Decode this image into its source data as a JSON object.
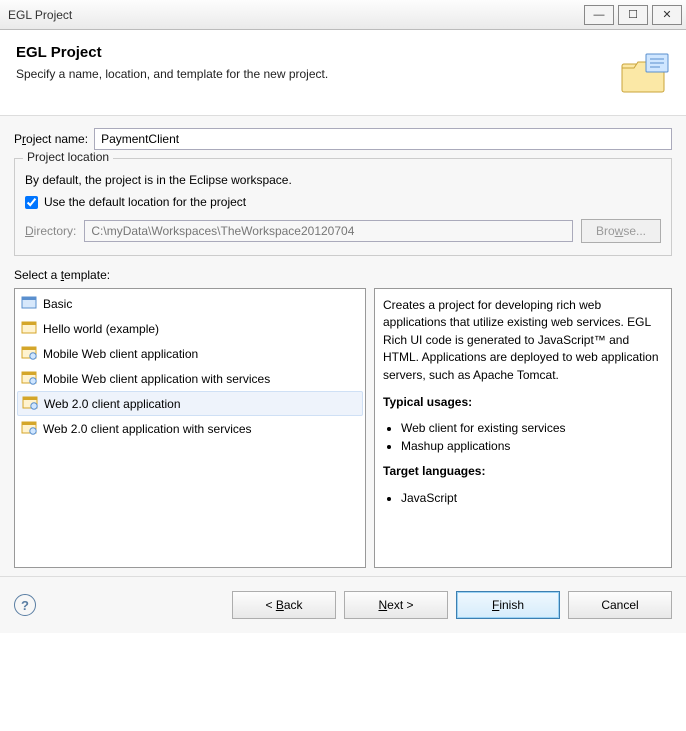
{
  "window": {
    "title": "EGL Project"
  },
  "header": {
    "title": "EGL Project",
    "subtitle": "Specify a name, location, and template for the new project."
  },
  "projectName": {
    "label_pre": "P",
    "label_u": "r",
    "label_post": "oject name:",
    "value": "PaymentClient"
  },
  "location": {
    "legend": "Project location",
    "desc": "By default, the project is in the Eclipse workspace.",
    "checkboxLabel": "Use the default location for the project",
    "checked": true,
    "dir_label_pre": "",
    "dir_label_u": "D",
    "dir_label_post": "irectory:",
    "directory": "C:\\myData\\Workspaces\\TheWorkspace20120704",
    "browse_pre": "Bro",
    "browse_u": "w",
    "browse_post": "se..."
  },
  "templates": {
    "label_pre": "Select a ",
    "label_u": "t",
    "label_post": "emplate:",
    "items": [
      {
        "label": "Basic",
        "icon": "basic"
      },
      {
        "label": "Hello world (example)",
        "icon": "hello"
      },
      {
        "label": "Mobile Web client application",
        "icon": "web"
      },
      {
        "label": "Mobile Web client application with services",
        "icon": "web"
      },
      {
        "label": "Web 2.0 client application",
        "icon": "web",
        "selected": true
      },
      {
        "label": "Web 2.0 client application with services",
        "icon": "web"
      }
    ],
    "desc": {
      "para": "Creates a project for developing rich web applications that utilize existing web services. EGL Rich UI code is generated to JavaScript™ and HTML. Applications are deployed to web application servers, such as Apache Tomcat.",
      "usagesHeading": "Typical usages:",
      "usages": [
        "Web client for existing services",
        "Mashup applications"
      ],
      "langHeading": "Target languages:",
      "langs": [
        "JavaScript"
      ]
    }
  },
  "buttons": {
    "back_pre": "< ",
    "back_u": "B",
    "back_post": "ack",
    "next_u": "N",
    "next_post": "ext >",
    "finish_u": "F",
    "finish_post": "inish",
    "cancel": "Cancel"
  }
}
